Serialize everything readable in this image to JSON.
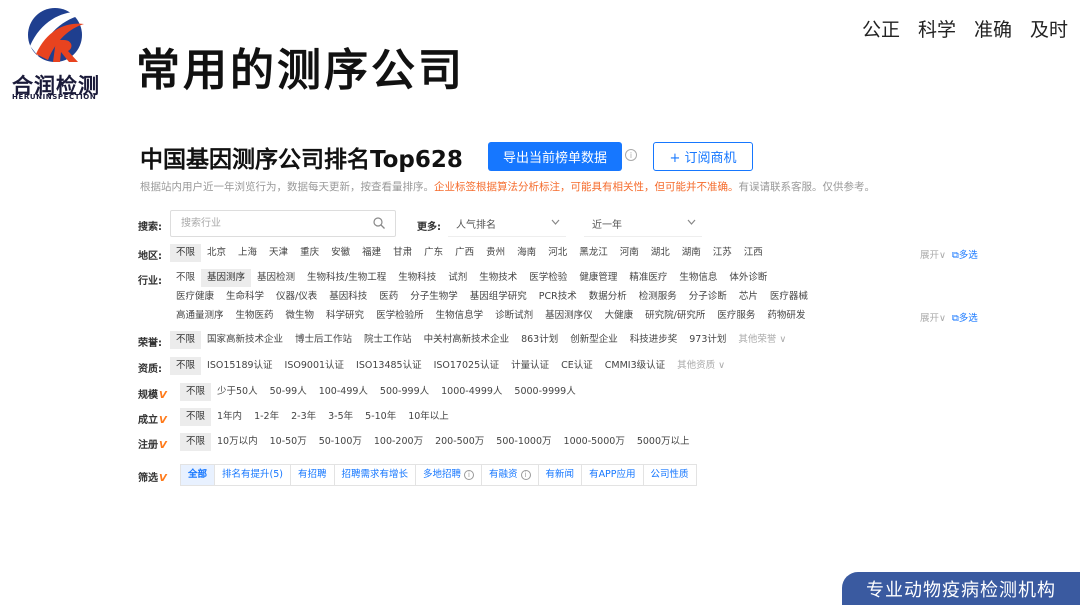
{
  "header": {
    "logo_name": "合润检测",
    "logo_sub": "HERUNINSPECTION",
    "slide_title": "常用的测序公司",
    "motto": [
      "公正",
      "科学",
      "准确",
      "及时"
    ]
  },
  "panel": {
    "title": "中国基因测序公司排名Top628",
    "export_button": "导出当前榜单数据",
    "subscribe_button": "+ 订阅商机",
    "notice_plain": "根据站内用户近一年浏览行为，数据每天更新，按查看量排序。",
    "notice_warn": "企业标签根据算法分析标注，可能具有相关性，但可能并不准确。",
    "notice_tail": "有误请联系客服。仅供参考。",
    "search_label": "搜索:",
    "search_placeholder": "搜索行业",
    "more_label": "更多:",
    "sort_select": "人气排名",
    "time_select": "近一年",
    "expand_label": "展开",
    "multi_label": "多选",
    "filters": {
      "region": {
        "label": "地区:",
        "items": [
          "不限",
          "北京",
          "上海",
          "天津",
          "重庆",
          "安徽",
          "福建",
          "甘肃",
          "广东",
          "广西",
          "贵州",
          "海南",
          "河北",
          "黑龙江",
          "河南",
          "湖北",
          "湖南",
          "江苏",
          "江西"
        ]
      },
      "industry": {
        "label": "行业:",
        "row1": [
          "不限",
          "基因测序",
          "基因检测",
          "生物科技/生物工程",
          "生物科技",
          "试剂",
          "生物技术",
          "医学检验",
          "健康管理",
          "精准医疗",
          "生物信息",
          "体外诊断"
        ],
        "row2": [
          "医疗健康",
          "生命科学",
          "仪器/仪表",
          "基因科技",
          "医药",
          "分子生物学",
          "基因组学研究",
          "PCR技术",
          "数据分析",
          "检测服务",
          "分子诊断",
          "芯片",
          "医疗器械"
        ],
        "row3": [
          "高通量测序",
          "生物医药",
          "微生物",
          "科学研究",
          "医学检验所",
          "生物信息学",
          "诊断试剂",
          "基因测序仪",
          "大健康",
          "研究院/研究所",
          "医疗服务",
          "药物研发"
        ]
      },
      "honor": {
        "label": "荣誉:",
        "items": [
          "不限",
          "国家高新技术企业",
          "博士后工作站",
          "院士工作站",
          "中关村高新技术企业",
          "863计划",
          "创新型企业",
          "科技进步奖",
          "973计划"
        ],
        "more": "其他荣誉"
      },
      "qualification": {
        "label": "资质:",
        "items": [
          "不限",
          "ISO15189认证",
          "ISO9001认证",
          "ISO13485认证",
          "ISO17025认证",
          "计量认证",
          "CE认证",
          "CMMI3级认证"
        ],
        "more": "其他资质"
      },
      "scale": {
        "label": "规模",
        "items": [
          "不限",
          "少于50人",
          "50-99人",
          "100-499人",
          "500-999人",
          "1000-4999人",
          "5000-9999人"
        ]
      },
      "founded": {
        "label": "成立",
        "items": [
          "不限",
          "1年内",
          "1-2年",
          "2-3年",
          "3-5年",
          "5-10年",
          "10年以上"
        ]
      },
      "capital": {
        "label": "注册",
        "items": [
          "不限",
          "10万以内",
          "10-50万",
          "50-100万",
          "100-200万",
          "200-500万",
          "500-1000万",
          "1000-5000万",
          "5000万以上"
        ]
      }
    },
    "screen": {
      "label": "筛选",
      "tabs": [
        "全部",
        "排名有提升(5)",
        "有招聘",
        "招聘需求有增长",
        "多地招聘",
        "有融资",
        "有新闻",
        "有APP应用",
        "公司性质"
      ]
    }
  },
  "footer": {
    "banner": "专业动物疫病检测机构"
  },
  "colors": {
    "accent": "#1677ff",
    "warning": "#f56c2d",
    "vip_mark": "#ff7a1a",
    "banner": "#3a5aa0"
  }
}
